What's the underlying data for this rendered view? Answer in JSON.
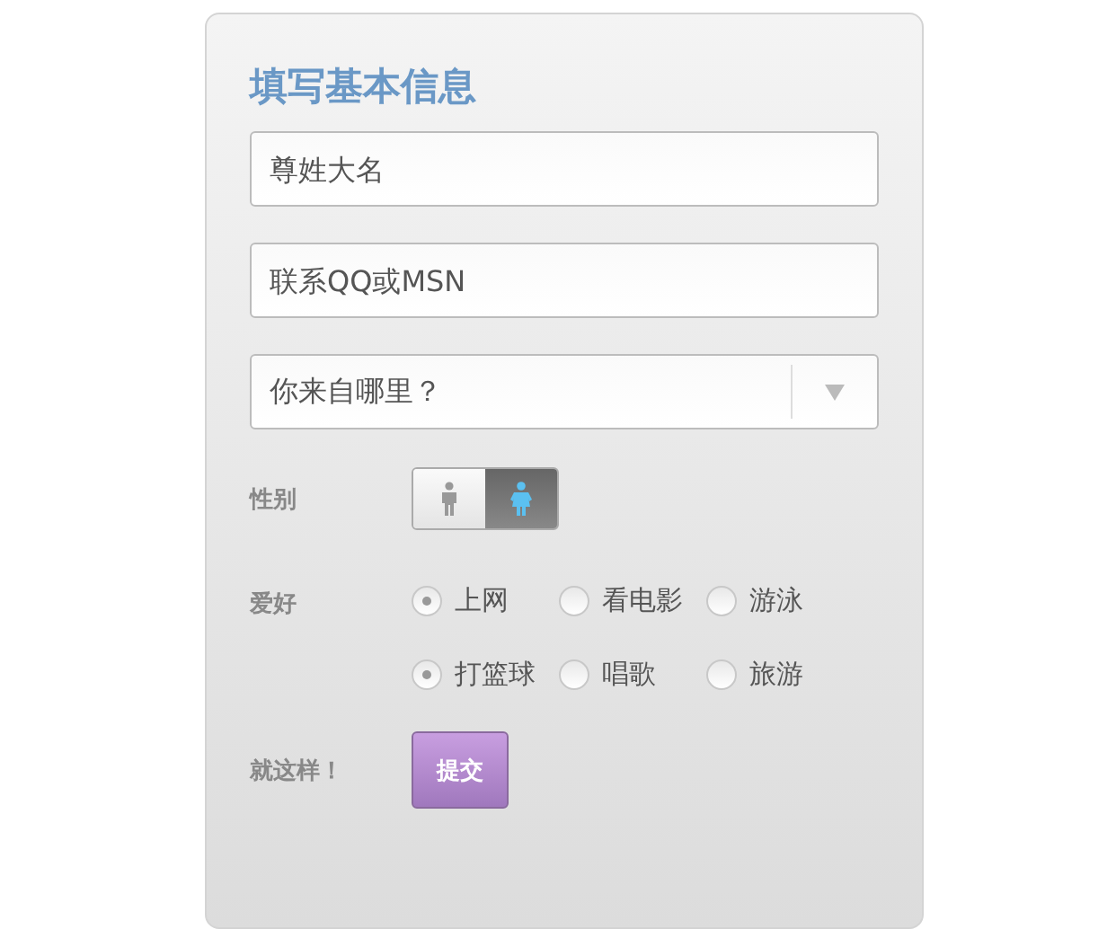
{
  "title": "填写基本信息",
  "name_field": {
    "placeholder": "尊姓大名"
  },
  "contact_field": {
    "placeholder": "联系QQ或MSN"
  },
  "region_select": {
    "placeholder": "你来自哪里？"
  },
  "gender": {
    "label": "性别",
    "options": [
      {
        "kind": "male",
        "selected": false
      },
      {
        "kind": "female",
        "selected": true
      }
    ]
  },
  "hobbies": {
    "label": "爱好",
    "options": [
      {
        "label": "上网",
        "checked": true
      },
      {
        "label": "看电影",
        "checked": false
      },
      {
        "label": "游泳",
        "checked": false
      },
      {
        "label": "打篮球",
        "checked": true
      },
      {
        "label": "唱歌",
        "checked": false
      },
      {
        "label": "旅游",
        "checked": false
      }
    ]
  },
  "submit": {
    "label": "就这样！",
    "button": "提交"
  }
}
